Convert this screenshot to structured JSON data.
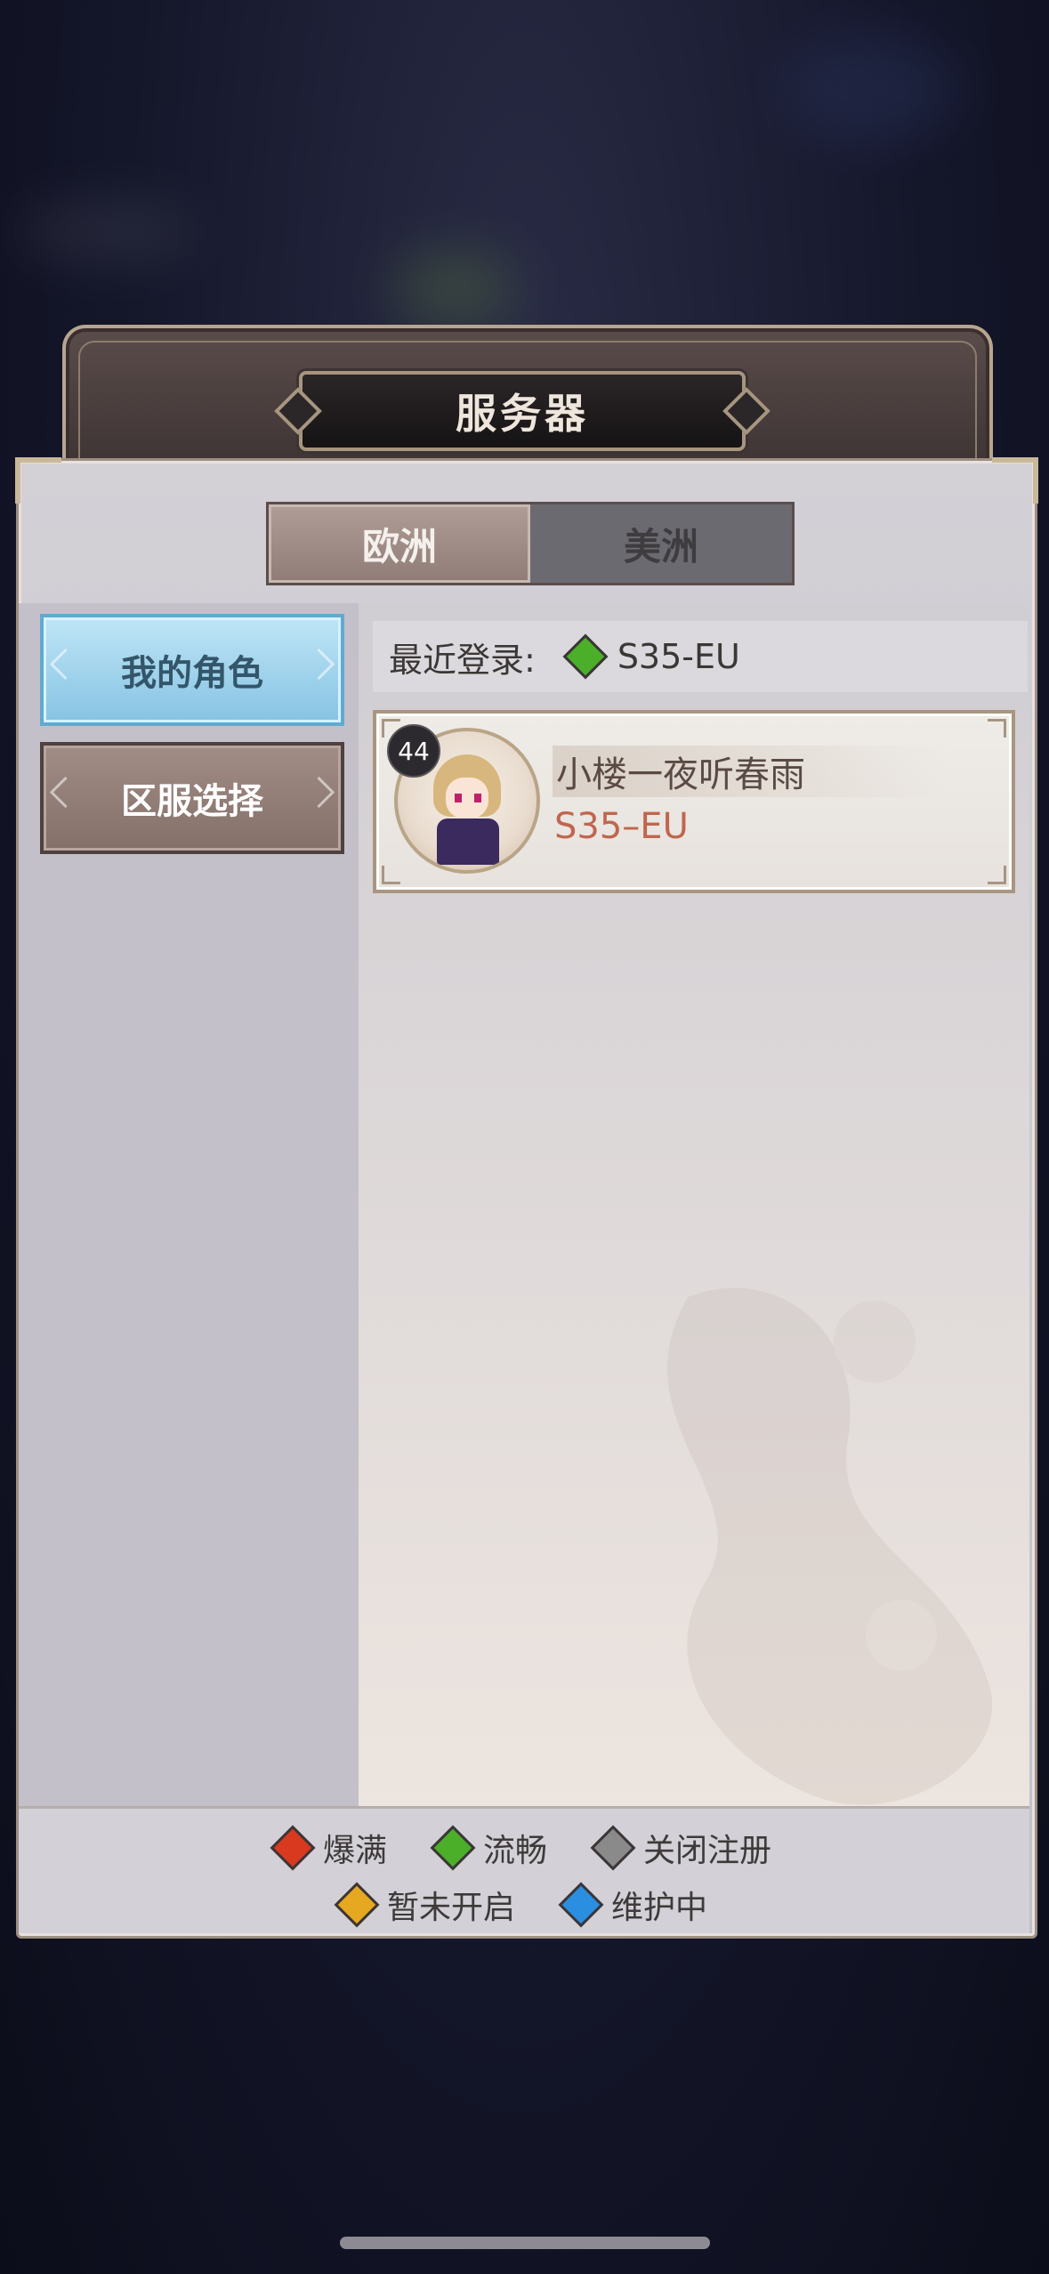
{
  "dialog": {
    "title": "服务器",
    "region_tabs": [
      {
        "label": "欧洲",
        "active": true
      },
      {
        "label": "美洲",
        "active": false
      }
    ],
    "side_menu": [
      {
        "label": "我的角色",
        "active": true
      },
      {
        "label": "区服选择",
        "active": false
      }
    ],
    "recent_login": {
      "label": "最近登录:",
      "server": "S35-EU",
      "status_color": "#4caf2a"
    },
    "character": {
      "level": "44",
      "name": "小楼一夜听春雨",
      "server": "S35–EU"
    },
    "legend": [
      {
        "label": "爆满",
        "color": "#d9391f"
      },
      {
        "label": "流畅",
        "color": "#4caf2a"
      },
      {
        "label": "关闭注册",
        "color": "#8a8a8a"
      },
      {
        "label": "暂未开启",
        "color": "#e6a820"
      },
      {
        "label": "维护中",
        "color": "#2a8fe0"
      }
    ]
  }
}
